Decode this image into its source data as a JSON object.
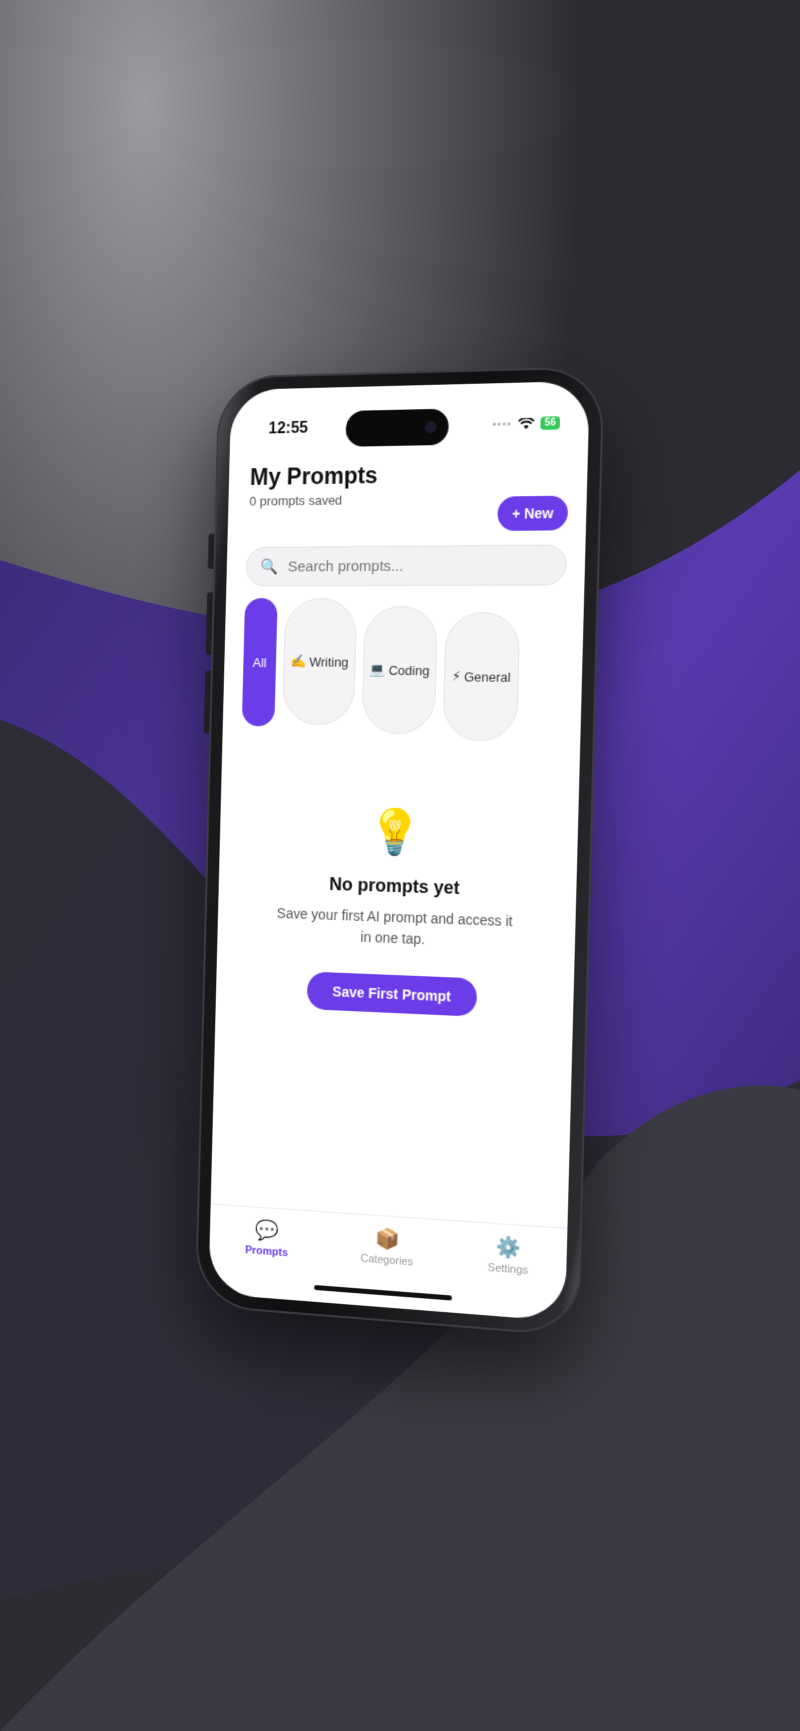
{
  "colors": {
    "accent": "#6a3de8",
    "battery": "#34c759"
  },
  "status_bar": {
    "time": "12:55",
    "signal": "••••",
    "battery": "56"
  },
  "header": {
    "title": "My Prompts",
    "count": "0 prompts saved",
    "new_label": "+ New"
  },
  "search": {
    "placeholder": "Search prompts..."
  },
  "filters": [
    {
      "label": "All",
      "icon": ""
    },
    {
      "label": "Writing",
      "icon": "✍️"
    },
    {
      "label": "Coding",
      "icon": "💻"
    },
    {
      "label": "General",
      "icon": "⚡"
    }
  ],
  "empty_state": {
    "icon": "💡",
    "title": "No prompts yet",
    "message": "Save your first AI prompt and access it in one tap.",
    "cta": "Save First Prompt"
  },
  "tabbar": [
    {
      "label": "Prompts",
      "icon": "💬"
    },
    {
      "label": "Categories",
      "icon": "📦"
    },
    {
      "label": "Settings",
      "icon": "⚙️"
    }
  ]
}
